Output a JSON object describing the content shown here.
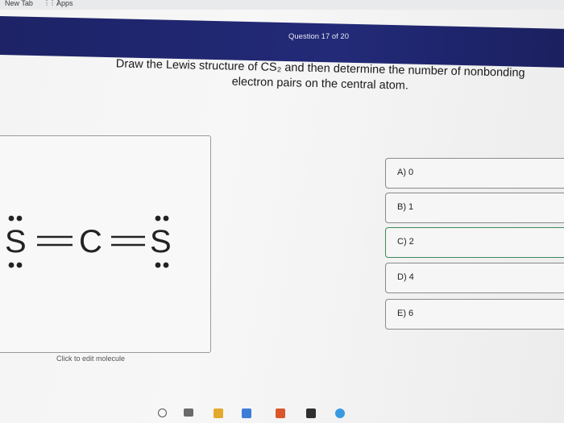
{
  "browser": {
    "tab_label": "New Tab",
    "apps_label": "Apps",
    "apps_icon": "apps-grid-icon"
  },
  "header": {
    "question_counter": "Question 17 of 20"
  },
  "question": {
    "prompt_line1": "Draw the Lewis structure of CS₂ and then determine the number of nonbonding",
    "prompt_line2": "electron pairs on the central atom."
  },
  "molecule_editor": {
    "atoms": [
      "S",
      "C",
      "S"
    ],
    "bonds": [
      "=",
      "="
    ],
    "edit_hint": "Click to edit molecule"
  },
  "answers": {
    "options": [
      {
        "label": "A) 0"
      },
      {
        "label": "B) 1"
      },
      {
        "label": "C) 2"
      },
      {
        "label": "D) 4"
      },
      {
        "label": "E) 6"
      }
    ]
  },
  "colors": {
    "header_bg": "#1f2570",
    "answer_border": "#8a8a8a",
    "accent_green": "#3c8a5a"
  }
}
